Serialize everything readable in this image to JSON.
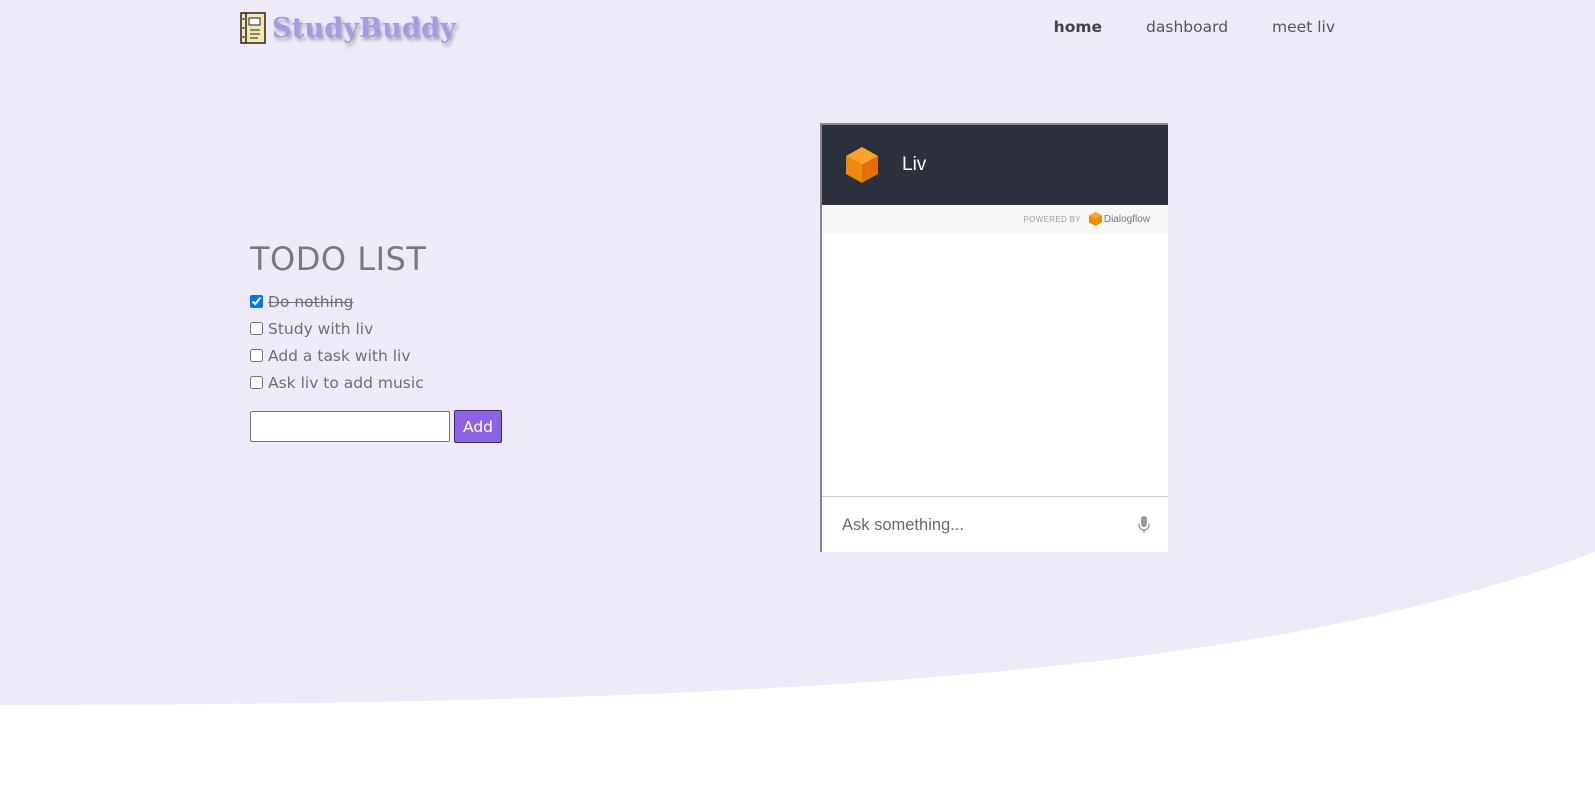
{
  "app": {
    "brand": "StudyBuddy"
  },
  "nav": {
    "items": [
      {
        "label": "home",
        "active": true
      },
      {
        "label": "dashboard",
        "active": false
      },
      {
        "label": "meet liv",
        "active": false
      }
    ]
  },
  "todo": {
    "title": "TODO LIST",
    "items": [
      {
        "label": "Do nothing",
        "checked": true
      },
      {
        "label": "Study with liv",
        "checked": false
      },
      {
        "label": "Add a task with liv",
        "checked": false
      },
      {
        "label": "Ask liv to add music",
        "checked": false
      }
    ],
    "input_value": "",
    "add_label": "Add"
  },
  "chat": {
    "bot_name": "Liv",
    "powered_by": "POWERED BY",
    "brand": "Dialogflow",
    "input_placeholder": "Ask something..."
  },
  "colors": {
    "hero_background": "#eeeaf8",
    "brand_text": "#a49be6",
    "add_button": "#8c63e4",
    "chat_header": "#2b303c",
    "bot_avatar": "#f5890f"
  },
  "icons": {
    "logo": "notebook-icon",
    "bot": "cube-icon",
    "powered_brand": "dialogflow-icon",
    "mic": "microphone-icon"
  }
}
